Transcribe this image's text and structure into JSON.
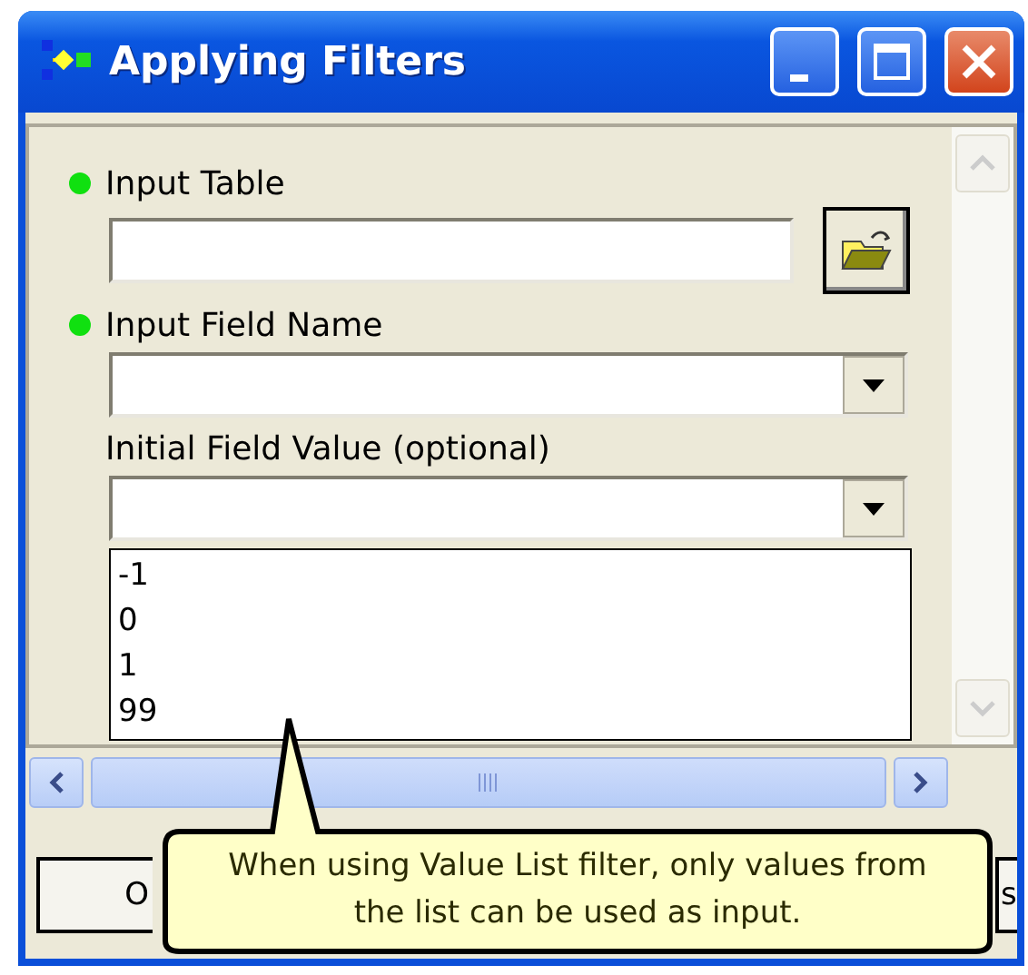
{
  "window": {
    "title": "Applying Filters"
  },
  "parameters": [
    {
      "kind": "text",
      "label": "Input Table",
      "required": true
    },
    {
      "kind": "combo",
      "label": "Input Field Name",
      "required": true
    },
    {
      "kind": "combo",
      "label": "Initial Field Value (optional)",
      "required": false
    }
  ],
  "value_list": [
    "-1",
    "0",
    "1",
    "99"
  ],
  "buttons": [
    {
      "label": "O"
    },
    {
      "label": "s"
    }
  ],
  "callout": {
    "text": "When using Value List filter, only values from the list can be used as input."
  }
}
